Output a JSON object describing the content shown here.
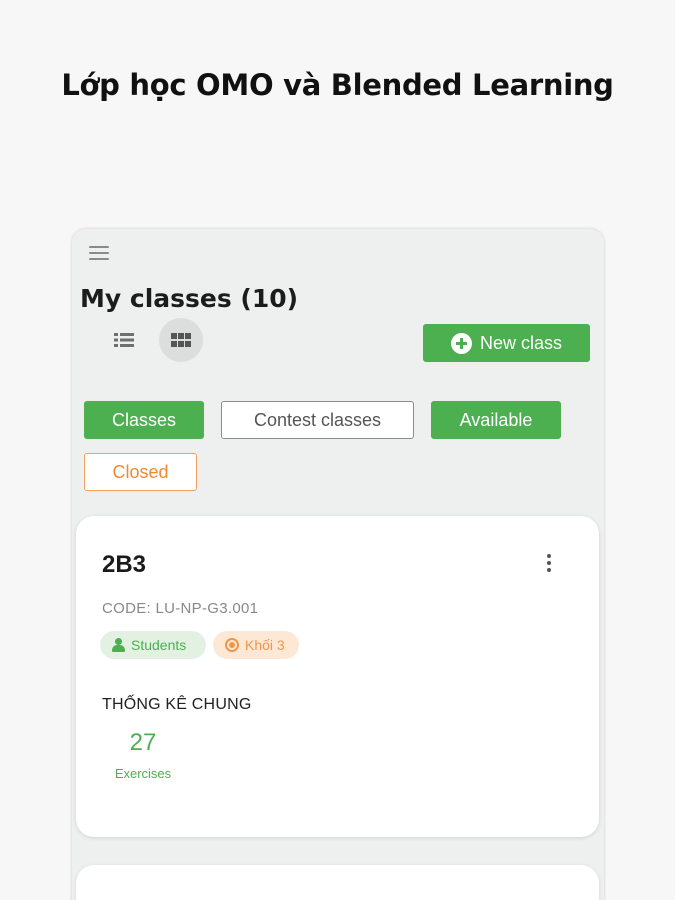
{
  "headline": "Lớp học OMO và Blended Learning",
  "page": {
    "title": "My classes (10)",
    "new_class_label": "New class"
  },
  "filters": {
    "classes": "Classes",
    "contest": "Contest classes",
    "available": "Available",
    "closed": "Closed"
  },
  "class_card": {
    "name": "2B3",
    "code": "CODE: LU-NP-G3.001",
    "tags": {
      "students": "Students",
      "grade": "Khối 3"
    },
    "stats_title": "THỐNG KÊ CHUNG",
    "exercises_value": "27",
    "exercises_label": "Exercises"
  },
  "colors": {
    "accent": "#4caf50",
    "closed_orange": "#ef8a2f",
    "grade_tag_bg": "#fde8d6",
    "students_tag_bg": "#e3f1e3"
  },
  "icons": {
    "menu": "hamburger-icon",
    "list_view": "list-view-icon",
    "grid_view": "grid-view-icon",
    "add": "plus-circle-icon",
    "more": "kebab-menu-icon",
    "students": "person-icon",
    "grade": "target-icon"
  }
}
